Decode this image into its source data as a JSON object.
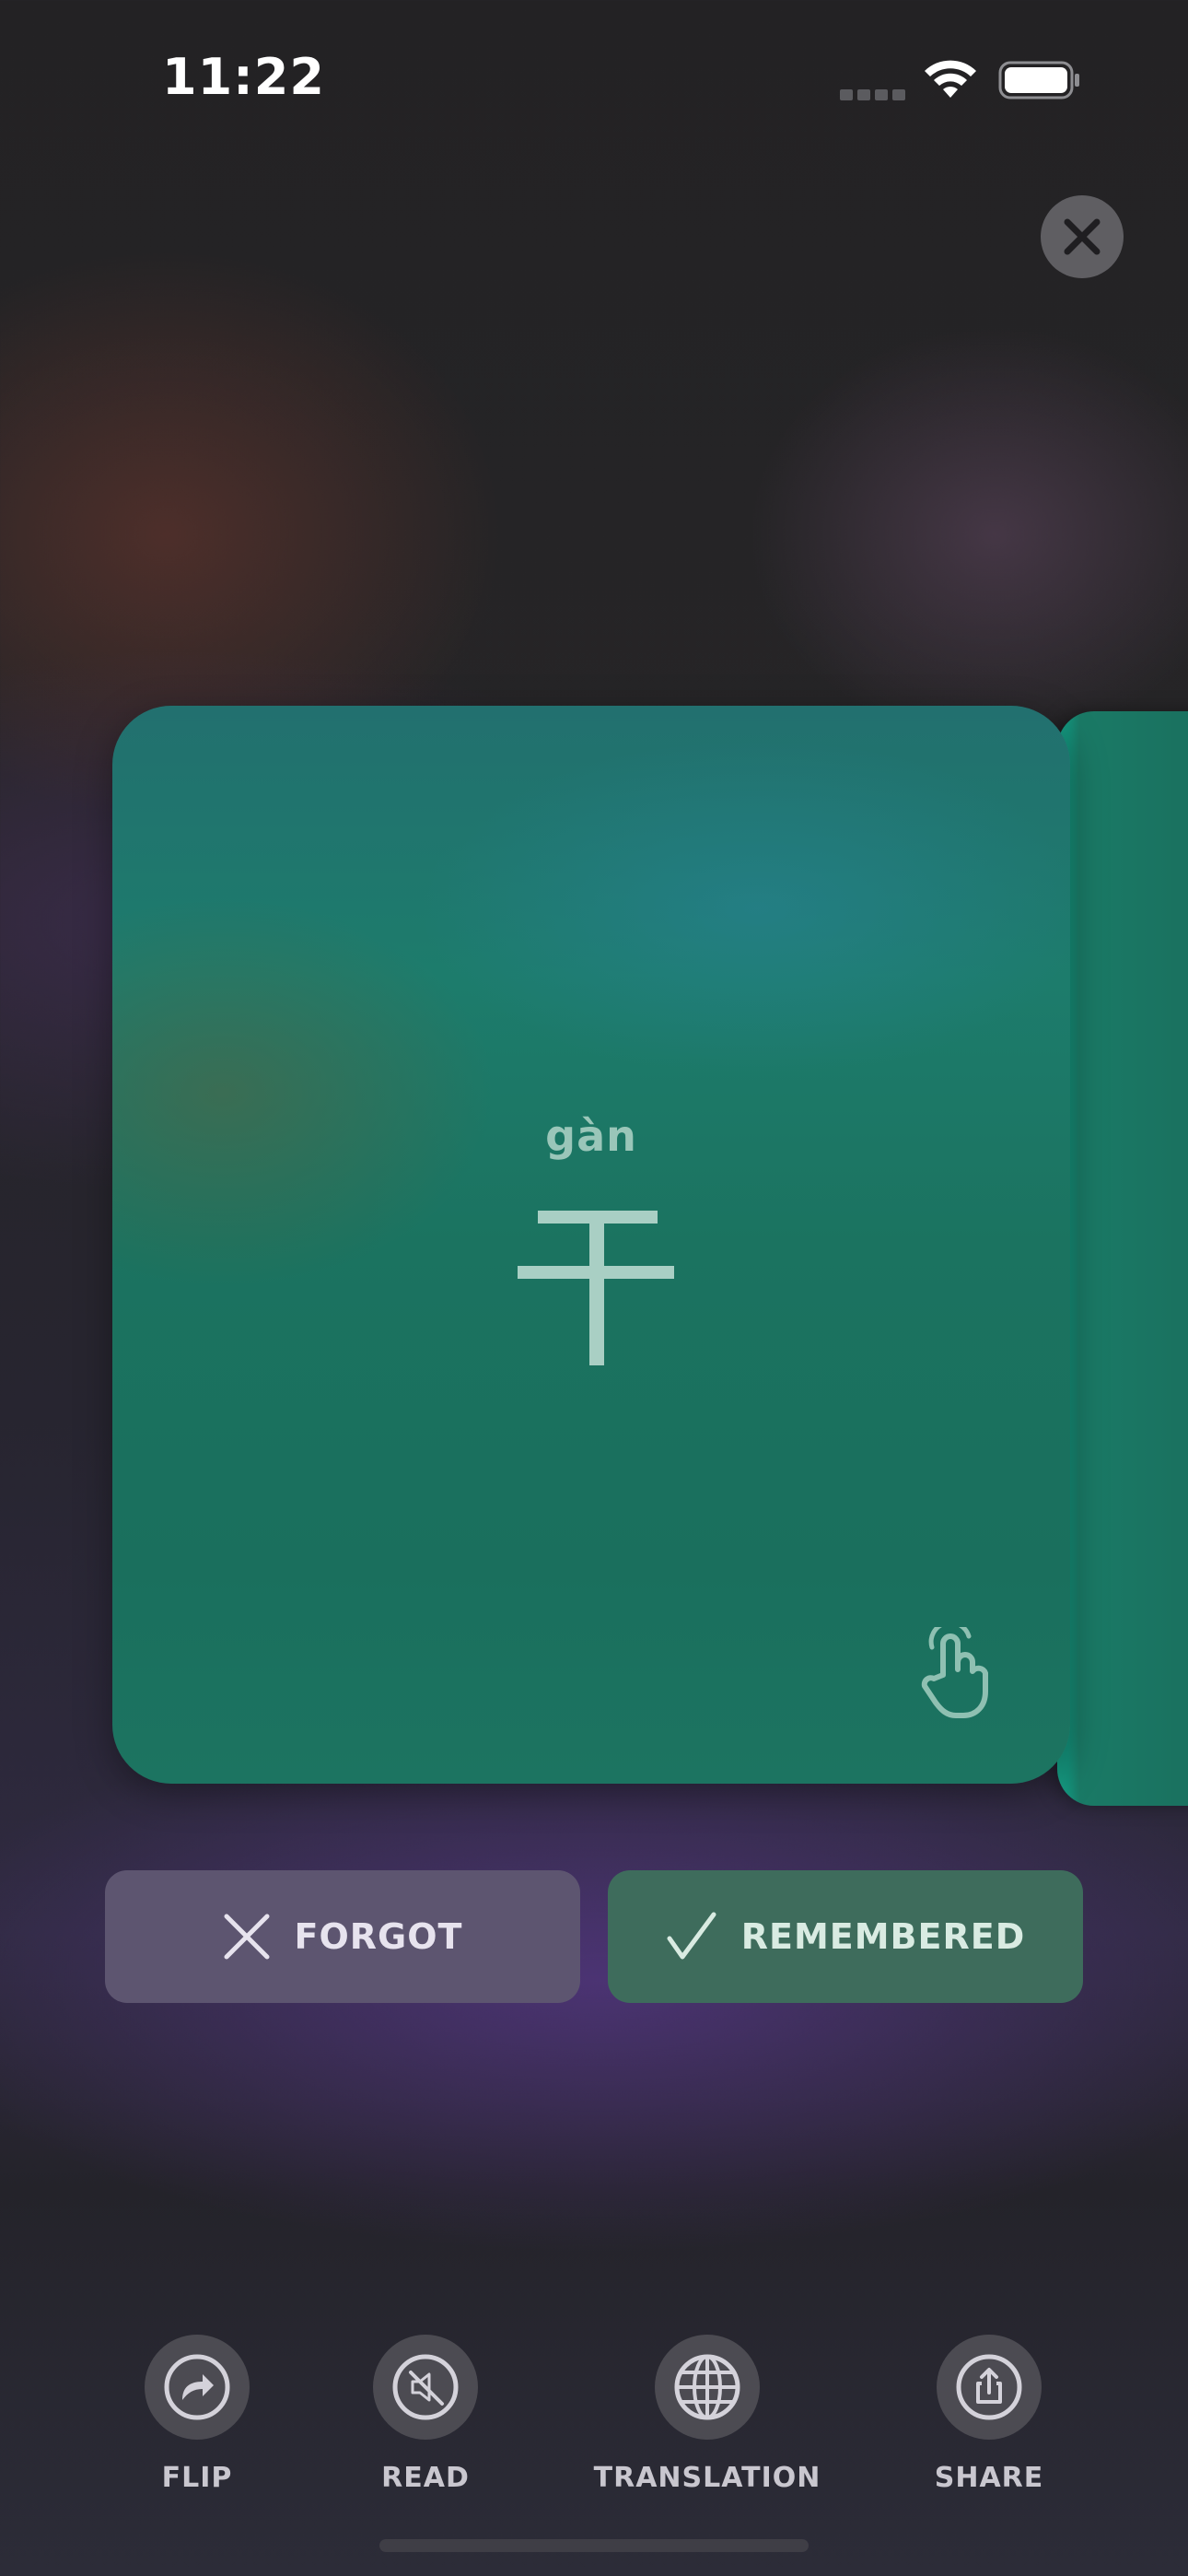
{
  "status_bar": {
    "time": "11:22"
  },
  "card": {
    "pinyin": "gàn",
    "character": "干"
  },
  "actions": {
    "forgot_label": "FORGOT",
    "remembered_label": "REMEMBERED"
  },
  "toolbar": [
    {
      "label": "FLIP",
      "icon": "flip-arrow-icon"
    },
    {
      "label": "READ",
      "icon": "speaker-muted-icon"
    },
    {
      "label": "TRANSLATION",
      "icon": "globe-icon"
    },
    {
      "label": "SHARE",
      "icon": "share-icon"
    }
  ],
  "colors": {
    "card_green": "#1b7360",
    "forgot_bg": "#5d5570",
    "remembered_bg": "#3e6c5c",
    "background": "#262527"
  }
}
